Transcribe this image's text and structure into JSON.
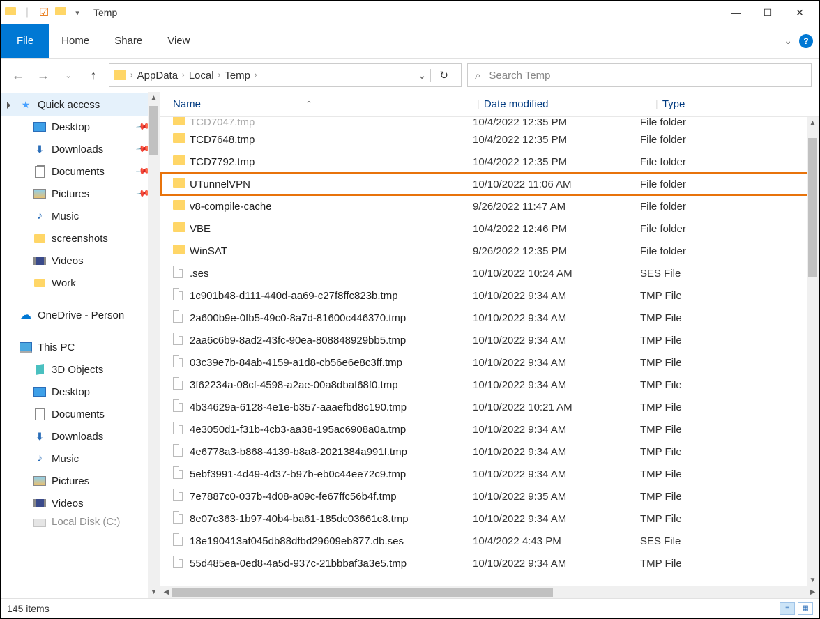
{
  "title": "Temp",
  "ribbon": {
    "file": "File",
    "home": "Home",
    "share": "Share",
    "view": "View"
  },
  "breadcrumb": [
    "AppData",
    "Local",
    "Temp"
  ],
  "search": {
    "placeholder": "Search Temp"
  },
  "sidebar": {
    "quick_access": "Quick access",
    "qa_items": [
      {
        "label": "Desktop",
        "icon": "i-desktop",
        "pinned": true
      },
      {
        "label": "Downloads",
        "icon": "i-downloads",
        "pinned": true
      },
      {
        "label": "Documents",
        "icon": "i-documents",
        "pinned": true
      },
      {
        "label": "Pictures",
        "icon": "i-pictures",
        "pinned": true
      },
      {
        "label": "Music",
        "icon": "i-music",
        "pinned": false
      },
      {
        "label": "screenshots",
        "icon": "i-folder",
        "pinned": false
      },
      {
        "label": "Videos",
        "icon": "i-videos",
        "pinned": false
      },
      {
        "label": "Work",
        "icon": "i-folder",
        "pinned": false
      }
    ],
    "onedrive": "OneDrive - Person",
    "this_pc": "This PC",
    "pc_items": [
      {
        "label": "3D Objects",
        "icon": "i-3d"
      },
      {
        "label": "Desktop",
        "icon": "i-desktop"
      },
      {
        "label": "Documents",
        "icon": "i-documents"
      },
      {
        "label": "Downloads",
        "icon": "i-downloads"
      },
      {
        "label": "Music",
        "icon": "i-music"
      },
      {
        "label": "Pictures",
        "icon": "i-pictures"
      },
      {
        "label": "Videos",
        "icon": "i-videos"
      },
      {
        "label": "Local Disk (C:)",
        "icon": "i-disk"
      }
    ]
  },
  "columns": {
    "name": "Name",
    "date": "Date modified",
    "type": "Type"
  },
  "cutoff": {
    "name": "TCD7047.tmp",
    "date": "10/4/2022 12:35 PM",
    "type": "File folder"
  },
  "rows": [
    {
      "ic": "folder",
      "name": "TCD7648.tmp",
      "date": "10/4/2022 12:35 PM",
      "type": "File folder",
      "hl": false
    },
    {
      "ic": "folder",
      "name": "TCD7792.tmp",
      "date": "10/4/2022 12:35 PM",
      "type": "File folder",
      "hl": false
    },
    {
      "ic": "folder",
      "name": "UTunnelVPN",
      "date": "10/10/2022 11:06 AM",
      "type": "File folder",
      "hl": true
    },
    {
      "ic": "folder",
      "name": "v8-compile-cache",
      "date": "9/26/2022 11:47 AM",
      "type": "File folder",
      "hl": false
    },
    {
      "ic": "folder",
      "name": "VBE",
      "date": "10/4/2022 12:46 PM",
      "type": "File folder",
      "hl": false
    },
    {
      "ic": "folder",
      "name": "WinSAT",
      "date": "9/26/2022 12:35 PM",
      "type": "File folder",
      "hl": false
    },
    {
      "ic": "file",
      "name": ".ses",
      "date": "10/10/2022 10:24 AM",
      "type": "SES File",
      "hl": false
    },
    {
      "ic": "file",
      "name": "1c901b48-d111-440d-aa69-c27f8ffc823b.tmp",
      "date": "10/10/2022 9:34 AM",
      "type": "TMP File",
      "hl": false
    },
    {
      "ic": "file",
      "name": "2a600b9e-0fb5-49c0-8a7d-81600c446370.tmp",
      "date": "10/10/2022 9:34 AM",
      "type": "TMP File",
      "hl": false
    },
    {
      "ic": "file",
      "name": "2aa6c6b9-8ad2-43fc-90ea-808848929bb5.tmp",
      "date": "10/10/2022 9:34 AM",
      "type": "TMP File",
      "hl": false
    },
    {
      "ic": "file",
      "name": "03c39e7b-84ab-4159-a1d8-cb56e6e8c3ff.tmp",
      "date": "10/10/2022 9:34 AM",
      "type": "TMP File",
      "hl": false
    },
    {
      "ic": "file",
      "name": "3f62234a-08cf-4598-a2ae-00a8dbaf68f0.tmp",
      "date": "10/10/2022 9:34 AM",
      "type": "TMP File",
      "hl": false
    },
    {
      "ic": "file",
      "name": "4b34629a-6128-4e1e-b357-aaaefbd8c190.tmp",
      "date": "10/10/2022 10:21 AM",
      "type": "TMP File",
      "hl": false
    },
    {
      "ic": "file",
      "name": "4e3050d1-f31b-4cb3-aa38-195ac6908a0a.tmp",
      "date": "10/10/2022 9:34 AM",
      "type": "TMP File",
      "hl": false
    },
    {
      "ic": "file",
      "name": "4e6778a3-b868-4139-b8a8-2021384a991f.tmp",
      "date": "10/10/2022 9:34 AM",
      "type": "TMP File",
      "hl": false
    },
    {
      "ic": "file",
      "name": "5ebf3991-4d49-4d37-b97b-eb0c44ee72c9.tmp",
      "date": "10/10/2022 9:34 AM",
      "type": "TMP File",
      "hl": false
    },
    {
      "ic": "file",
      "name": "7e7887c0-037b-4d08-a09c-fe67ffc56b4f.tmp",
      "date": "10/10/2022 9:35 AM",
      "type": "TMP File",
      "hl": false
    },
    {
      "ic": "file",
      "name": "8e07c363-1b97-40b4-ba61-185dc03661c8.tmp",
      "date": "10/10/2022 9:34 AM",
      "type": "TMP File",
      "hl": false
    },
    {
      "ic": "file",
      "name": "18e190413af045db88dfbd29609eb877.db.ses",
      "date": "10/4/2022 4:43 PM",
      "type": "SES File",
      "hl": false
    },
    {
      "ic": "file",
      "name": "55d485ea-0ed8-4a5d-937c-21bbbaf3a3e5.tmp",
      "date": "10/10/2022 9:34 AM",
      "type": "TMP File",
      "hl": false
    }
  ],
  "status": {
    "count": "145 items"
  }
}
